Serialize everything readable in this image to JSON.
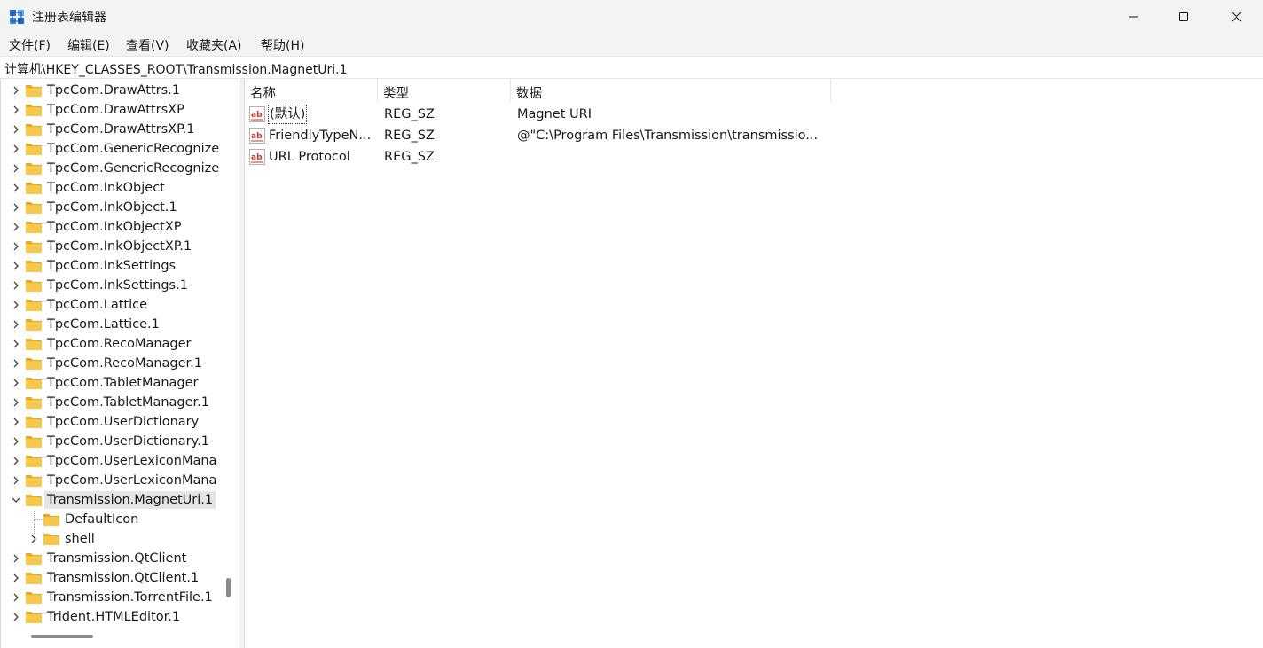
{
  "window": {
    "title": "注册表编辑器"
  },
  "menu": [
    {
      "label": "文件(F)"
    },
    {
      "label": "编辑(E)"
    },
    {
      "label": "查看(V)"
    },
    {
      "label": "收藏夹(A)"
    },
    {
      "label": "帮助(H)"
    }
  ],
  "address": "计算机\\HKEY_CLASSES_ROOT\\Transmission.MagnetUri.1",
  "tree": [
    {
      "label": "TpcCom.DrawAttrs.1",
      "level": 0,
      "expander": "collapsed"
    },
    {
      "label": "TpcCom.DrawAttrsXP",
      "level": 0,
      "expander": "collapsed"
    },
    {
      "label": "TpcCom.DrawAttrsXP.1",
      "level": 0,
      "expander": "collapsed"
    },
    {
      "label": "TpcCom.GenericRecognize",
      "level": 0,
      "expander": "collapsed"
    },
    {
      "label": "TpcCom.GenericRecognize",
      "level": 0,
      "expander": "collapsed"
    },
    {
      "label": "TpcCom.InkObject",
      "level": 0,
      "expander": "collapsed"
    },
    {
      "label": "TpcCom.InkObject.1",
      "level": 0,
      "expander": "collapsed"
    },
    {
      "label": "TpcCom.InkObjectXP",
      "level": 0,
      "expander": "collapsed"
    },
    {
      "label": "TpcCom.InkObjectXP.1",
      "level": 0,
      "expander": "collapsed"
    },
    {
      "label": "TpcCom.InkSettings",
      "level": 0,
      "expander": "collapsed"
    },
    {
      "label": "TpcCom.InkSettings.1",
      "level": 0,
      "expander": "collapsed"
    },
    {
      "label": "TpcCom.Lattice",
      "level": 0,
      "expander": "collapsed"
    },
    {
      "label": "TpcCom.Lattice.1",
      "level": 0,
      "expander": "collapsed"
    },
    {
      "label": "TpcCom.RecoManager",
      "level": 0,
      "expander": "collapsed"
    },
    {
      "label": "TpcCom.RecoManager.1",
      "level": 0,
      "expander": "collapsed"
    },
    {
      "label": "TpcCom.TabletManager",
      "level": 0,
      "expander": "collapsed"
    },
    {
      "label": "TpcCom.TabletManager.1",
      "level": 0,
      "expander": "collapsed"
    },
    {
      "label": "TpcCom.UserDictionary",
      "level": 0,
      "expander": "collapsed"
    },
    {
      "label": "TpcCom.UserDictionary.1",
      "level": 0,
      "expander": "collapsed"
    },
    {
      "label": "TpcCom.UserLexiconMana",
      "level": 0,
      "expander": "collapsed"
    },
    {
      "label": "TpcCom.UserLexiconMana",
      "level": 0,
      "expander": "collapsed"
    },
    {
      "label": "Transmission.MagnetUri.1",
      "level": 0,
      "expander": "expanded",
      "selected": true
    },
    {
      "label": "DefaultIcon",
      "level": 1,
      "expander": "none"
    },
    {
      "label": "shell",
      "level": 1,
      "expander": "collapsed"
    },
    {
      "label": "Transmission.QtClient",
      "level": 0,
      "expander": "collapsed"
    },
    {
      "label": "Transmission.QtClient.1",
      "level": 0,
      "expander": "collapsed"
    },
    {
      "label": "Transmission.TorrentFile.1",
      "level": 0,
      "expander": "collapsed"
    },
    {
      "label": "Trident.HTMLEditor.1",
      "level": 0,
      "expander": "collapsed"
    }
  ],
  "columns": {
    "name": "名称",
    "type": "类型",
    "data": "数据"
  },
  "values": [
    {
      "name": "(默认)",
      "type": "REG_SZ",
      "data": "Magnet URI",
      "icon": "reg-sz-icon"
    },
    {
      "name": "FriendlyTypeN...",
      "type": "REG_SZ",
      "data": "@\"C:\\Program Files\\Transmission\\transmissio...",
      "icon": "reg-sz-icon"
    },
    {
      "name": "URL Protocol",
      "type": "REG_SZ",
      "data": "",
      "icon": "reg-sz-icon"
    }
  ],
  "colors": {
    "chrome": "#f3f3f3",
    "selection": "#e5e5e5",
    "folder": "#f5c84c"
  }
}
